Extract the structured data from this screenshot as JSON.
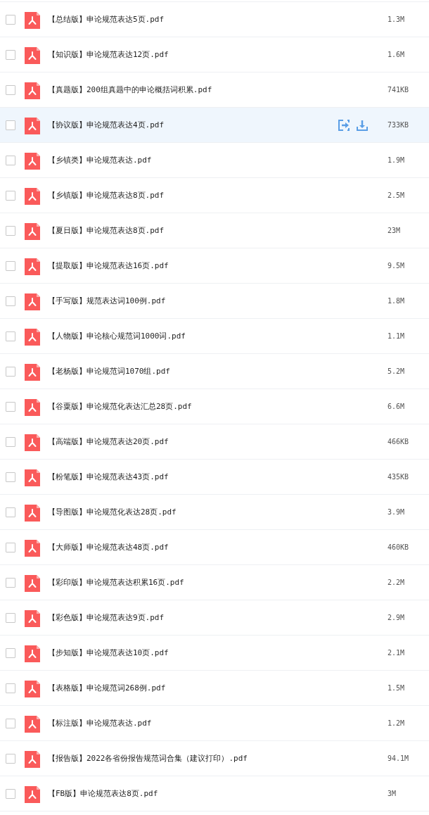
{
  "files": [
    {
      "name": "【总结版】申论规范表达5页.pdf",
      "size": "1.3M",
      "checked": false,
      "hovered": false
    },
    {
      "name": "【知识版】申论规范表达12页.pdf",
      "size": "1.6M",
      "checked": false,
      "hovered": false
    },
    {
      "name": "【真题版】200组真题中的申论概括词积累.pdf",
      "size": "741KB",
      "checked": false,
      "hovered": false
    },
    {
      "name": "【协议版】申论规范表达4页.pdf",
      "size": "733KB",
      "checked": false,
      "hovered": true
    },
    {
      "name": "【乡镇类】申论规范表达.pdf",
      "size": "1.9M",
      "checked": false,
      "hovered": false
    },
    {
      "name": "【乡镇版】申论规范表达8页.pdf",
      "size": "2.5M",
      "checked": false,
      "hovered": false
    },
    {
      "name": "【夏日版】申论规范表达8页.pdf",
      "size": "23M",
      "checked": false,
      "hovered": false
    },
    {
      "name": "【提取版】申论规范表达16页.pdf",
      "size": "9.5M",
      "checked": false,
      "hovered": false
    },
    {
      "name": "【手写版】规范表达词100例.pdf",
      "size": "1.8M",
      "checked": false,
      "hovered": false
    },
    {
      "name": "【人物版】申论核心规范词1000词.pdf",
      "size": "1.1M",
      "checked": false,
      "hovered": false
    },
    {
      "name": "【老杨版】申论规范词1070组.pdf",
      "size": "5.2M",
      "checked": false,
      "hovered": false
    },
    {
      "name": "【谷粟版】申论规范化表达汇总28页.pdf",
      "size": "6.6M",
      "checked": false,
      "hovered": false
    },
    {
      "name": "【高端版】申论规范表达20页.pdf",
      "size": "466KB",
      "checked": false,
      "hovered": false
    },
    {
      "name": "【粉笔版】申论规范表达43页.pdf",
      "size": "435KB",
      "checked": false,
      "hovered": false
    },
    {
      "name": "【导图版】申论规范化表达28页.pdf",
      "size": "3.9M",
      "checked": false,
      "hovered": false
    },
    {
      "name": "【大师版】申论规范表达48页.pdf",
      "size": "460KB",
      "checked": false,
      "hovered": false
    },
    {
      "name": "【彩印版】申论规范表达积累16页.pdf",
      "size": "2.2M",
      "checked": false,
      "hovered": false
    },
    {
      "name": "【彩色版】申论规范表达9页.pdf",
      "size": "2.9M",
      "checked": false,
      "hovered": false
    },
    {
      "name": "【步知版】申论规范表达10页.pdf",
      "size": "2.1M",
      "checked": false,
      "hovered": false
    },
    {
      "name": "【表格版】申论规范词268例.pdf",
      "size": "1.5M",
      "checked": false,
      "hovered": false
    },
    {
      "name": "【标注版】申论规范表达.pdf",
      "size": "1.2M",
      "checked": false,
      "hovered": false
    },
    {
      "name": "【报告版】2022各省份报告规范词合集（建议打印）.pdf",
      "size": "94.1M",
      "checked": false,
      "hovered": false
    },
    {
      "name": "【FB版】申论规范表达8页.pdf",
      "size": "3M",
      "checked": false,
      "hovered": false
    }
  ]
}
